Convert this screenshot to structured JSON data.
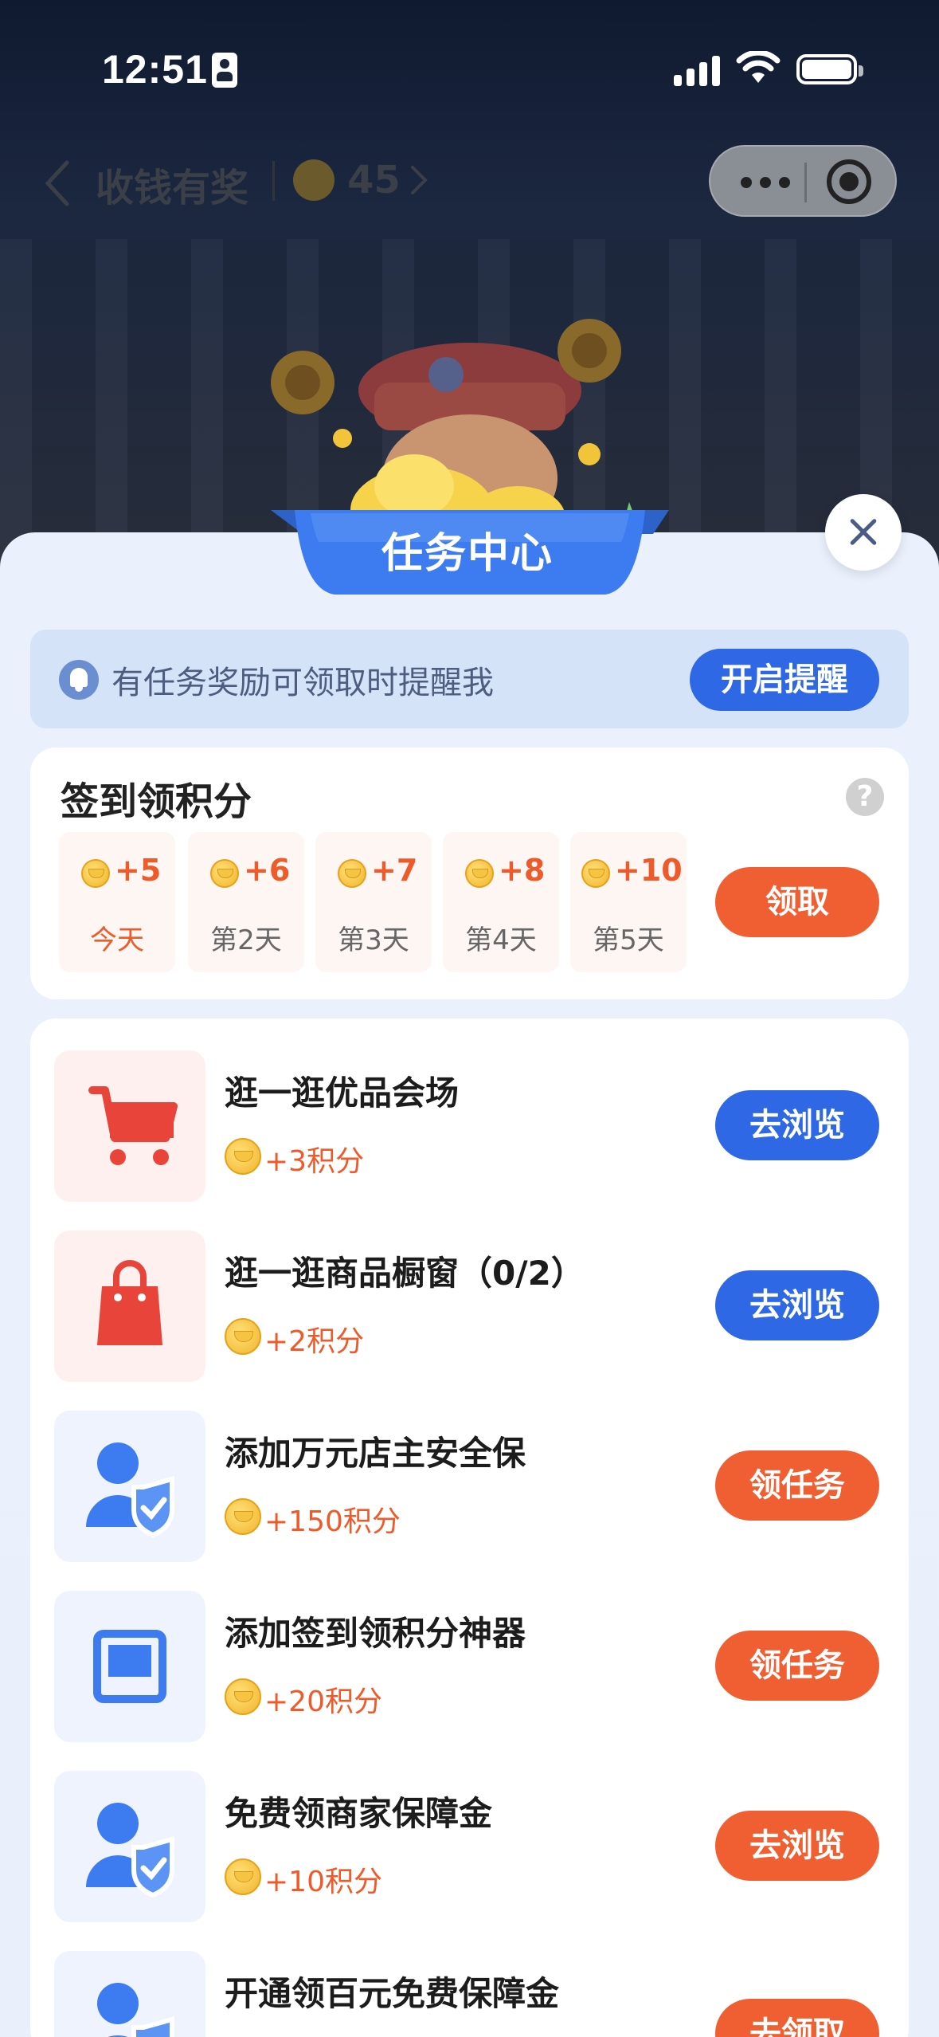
{
  "status_bar": {
    "time": "12:51"
  },
  "nav": {
    "title": "收钱有奖",
    "coin_count": "45"
  },
  "colors": {
    "primary_blue": "#2e68e4",
    "accent_orange": "#ef5f31",
    "reward_orange": "#ef5a2a",
    "sheet_bg": "#eaf1fc"
  },
  "sheet": {
    "banner_title": "任务中心",
    "close_icon": "close-icon"
  },
  "reminder": {
    "text": "有任务奖励可领取时提醒我",
    "button": "开启提醒",
    "icon": "bell-icon"
  },
  "signin": {
    "title": "签到领积分",
    "help_icon": "?",
    "days": [
      {
        "points": "+5",
        "label": "今天",
        "today": true
      },
      {
        "points": "+6",
        "label": "第2天",
        "today": false
      },
      {
        "points": "+7",
        "label": "第3天",
        "today": false
      },
      {
        "points": "+8",
        "label": "第4天",
        "today": false
      },
      {
        "points": "+10",
        "label": "第5天",
        "today": false
      }
    ],
    "claim_button": "领取"
  },
  "tasks": [
    {
      "title": "逛一逛优品会场",
      "reward": "+3积分",
      "button": "去浏览",
      "button_color": "blue",
      "icon": "shopping-cart-icon"
    },
    {
      "title": "逛一逛商品橱窗（0/2）",
      "reward": "+2积分",
      "button": "去浏览",
      "button_color": "blue",
      "icon": "shopping-bag-icon"
    },
    {
      "title": "添加万元店主安全保",
      "reward": "+150积分",
      "button": "领任务",
      "button_color": "orange",
      "icon": "user-shield-icon"
    },
    {
      "title": "添加签到领积分神器",
      "reward": "+20积分",
      "button": "领任务",
      "button_color": "orange",
      "icon": "monitor-icon"
    },
    {
      "title": "免费领商家保障金",
      "reward": "+10积分",
      "button": "去浏览",
      "button_color": "orange",
      "icon": "user-shield-icon"
    },
    {
      "title": "开通领百元免费保障金",
      "reward": "",
      "button": "去领取",
      "button_color": "orange",
      "icon": "user-shield-icon"
    }
  ]
}
